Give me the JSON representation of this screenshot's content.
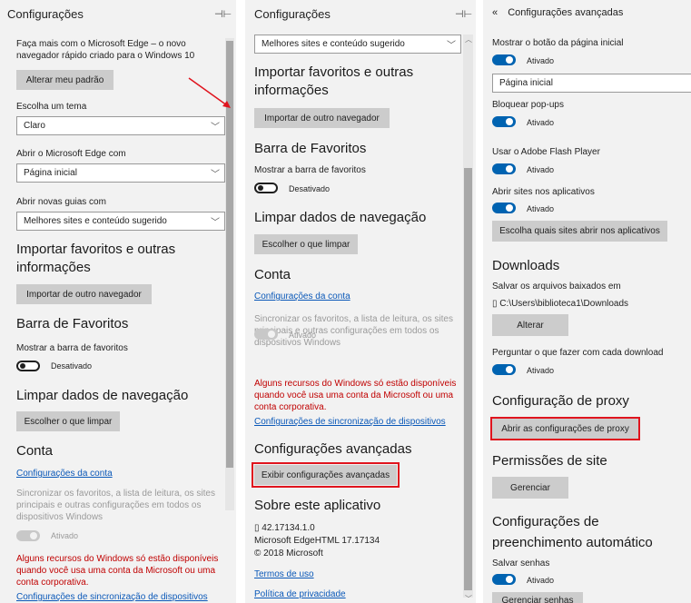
{
  "panel1": {
    "header": "Configurações",
    "promo_text": "Faça mais com o Microsoft Edge – o novo navegador rápido criado para o Windows 10",
    "change_default_btn": "Alterar meu padrão",
    "theme_label": "Escolha um tema",
    "theme_value": "Claro",
    "open_with_label": "Abrir o Microsoft Edge com",
    "open_with_value": "Página inicial",
    "new_tabs_label": "Abrir novas guias com",
    "new_tabs_value": "Melhores sites e conteúdo sugerido",
    "import_heading": "Importar favoritos e outras informações",
    "import_btn": "Importar de outro navegador",
    "favbar_heading": "Barra de Favoritos",
    "favbar_label": "Mostrar a barra de favoritos",
    "favbar_state": "Desativado",
    "clear_heading": "Limpar dados de navegação",
    "clear_btn": "Escolher o que limpar",
    "account_heading": "Conta",
    "account_link": "Configurações da conta",
    "sync_text": "Sincronizar os favoritos, a lista de leitura, os sites principais e outras configurações em todos os dispositivos Windows",
    "sync_state": "Ativado",
    "warning_text": "Alguns recursos do Windows só estão disponíveis quando você usa uma conta da Microsoft ou uma conta corporativa.",
    "device_sync_link": "Configurações de sincronização de dispositivos"
  },
  "panel2": {
    "header": "Configurações",
    "new_tabs_value": "Melhores sites e conteúdo sugerido",
    "import_heading": "Importar favoritos e outras informações",
    "import_btn": "Importar de outro navegador",
    "favbar_heading": "Barra de Favoritos",
    "favbar_label": "Mostrar a barra de favoritos",
    "favbar_state": "Desativado",
    "clear_heading": "Limpar dados de navegação",
    "clear_btn": "Escolher o que limpar",
    "account_heading": "Conta",
    "account_link": "Configurações da conta",
    "sync_text": "Sincronizar os favoritos, a lista de leitura, os sites principais e outras configurações em todos os dispositivos Windows",
    "sync_state": "Ativado",
    "warning_text": "Alguns recursos do Windows só estão disponíveis quando você usa uma conta da Microsoft ou uma conta corporativa.",
    "device_sync_link": "Configurações de sincronização de dispositivos",
    "advanced_heading": "Configurações avançadas",
    "advanced_btn": "Exibir configurações avançadas",
    "about_heading": "Sobre este aplicativo",
    "version": "42.17134.1.0",
    "edgehtml": "Microsoft EdgeHTML 17.17134",
    "copyright": "© 2018 Microsoft",
    "terms_link": "Termos de uso",
    "privacy_link": "Política de privacidade"
  },
  "panel3": {
    "header": "Configurações avançadas",
    "back_glyph": "«",
    "home_btn_label": "Mostrar o botão da página inicial",
    "home_btn_state": "Ativado",
    "home_page_value": "Página inicial",
    "popups_label": "Bloquear pop-ups",
    "popups_state": "Ativado",
    "flash_label": "Usar o Adobe Flash Player",
    "flash_state": "Ativado",
    "open_apps_label": "Abrir sites nos aplicativos",
    "open_apps_state": "Ativado",
    "choose_apps_btn": "Escolha quais sites abrir nos aplicativos",
    "downloads_heading": "Downloads",
    "save_path_label": "Salvar os arquivos baixados em",
    "save_path_value": "C:\\Users\\biblioteca1\\Downloads",
    "change_btn": "Alterar",
    "ask_label": "Perguntar o que fazer com cada download",
    "ask_state": "Ativado",
    "proxy_heading": "Configuração de proxy",
    "proxy_btn": "Abrir as configurações de proxy",
    "perm_heading": "Permissões de site",
    "manage_btn": "Gerenciar",
    "autofill_heading": "Configurações de preenchimento automático",
    "save_pw_label": "Salvar senhas",
    "save_pw_state": "Ativado",
    "manage_pw_btn": "Gerenciar senhas"
  },
  "colors": {
    "accent": "#0063b1",
    "link": "#0a58b8",
    "highlight": "#e0141e",
    "warning": "#c00000"
  },
  "icons": {
    "pin": "pin-icon",
    "back": "back-icon",
    "chevron": "chevron-down-icon",
    "folder": "folder-icon"
  }
}
